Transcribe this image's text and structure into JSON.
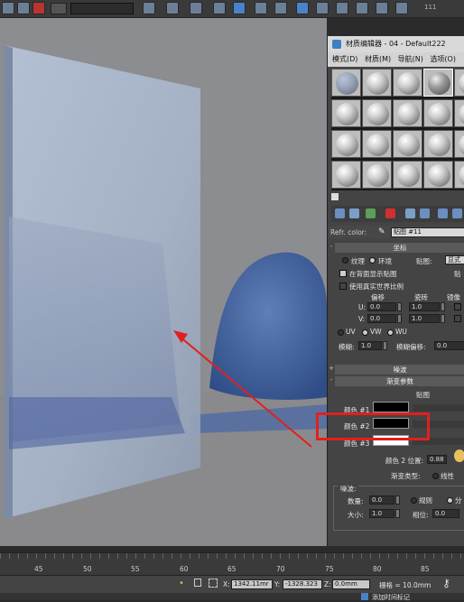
{
  "toolbar": {
    "view_dropdown": "",
    "counter": "111"
  },
  "material_editor": {
    "title": "材质编辑器 - 04 - Default222",
    "menu": [
      "模式(D)",
      "材质(M)",
      "导航(N)",
      "选项(O)"
    ],
    "refr_color_label": "Refr. color:",
    "map_name": "贴图 #11",
    "coordinates": {
      "header": "坐标",
      "texture_option": "纹理",
      "environment_option": "环境",
      "map_label": "贴图:",
      "map_dropdown": "显式",
      "show_map_on_back": "在背面显示贴图",
      "show_map_on_back_suffix": "贴",
      "use_real_world_scale": "使用真实世界比例",
      "offset_label": "偏移",
      "tiling_label": "瓷砖",
      "mirror_label": "镜像",
      "u_label": "U:",
      "v_label": "V:",
      "u_offset": "0.0",
      "v_offset": "0.0",
      "u_tiling": "1.0",
      "v_tiling": "1.0",
      "uv": "UV",
      "vw": "VW",
      "wu": "WU",
      "blur_label": "模糊:",
      "blur_value": "1.0",
      "blur_offset_label": "模糊偏移:",
      "blur_offset_value": "0.0"
    },
    "noise_header": "噪波",
    "gradient": {
      "header": "渐变参数",
      "map_label": "贴图",
      "color1_label": "颜色 #1",
      "color2_label": "颜色 #2",
      "color3_label": "颜色 #3",
      "color1": "#000000",
      "color2": "#000000",
      "color3": "#ffffff",
      "color2_position_label": "颜色 2 位置:",
      "color2_position_value": "0.88",
      "gradient_type_label": "渐变类型:",
      "gradient_type_value": "线性"
    },
    "noise": {
      "label": "噪波:",
      "amount_label": "数量:",
      "amount_value": "0.0",
      "regular_label": "规则",
      "fractal_label": "分",
      "size_label": "大小:",
      "size_value": "1.0",
      "phase_label": "相位:",
      "phase_value": "0.0"
    }
  },
  "timeline": {
    "ticks": [
      "45",
      "50",
      "55",
      "60",
      "65",
      "70",
      "75",
      "80",
      "85"
    ]
  },
  "statusbar": {
    "x_label": "X:",
    "x_value": "1342.11mr",
    "y_label": "Y:",
    "y_value": "-1328.323",
    "z_label": "Z:",
    "z_value": "0.0mm",
    "grid_label": "栅格 = 10.0mm",
    "add_time_tag": "添加时间标记"
  },
  "annotation": {
    "highlight_color": "#e02020"
  }
}
